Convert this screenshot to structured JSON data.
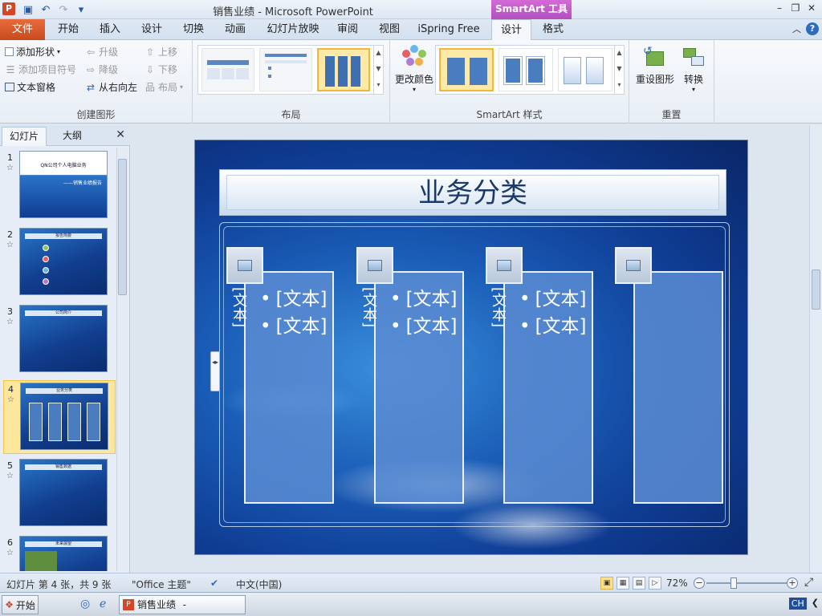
{
  "titlebar": {
    "window_title": "销售业绩 - Microsoft PowerPoint",
    "context_tools": "SmartArt 工具"
  },
  "tabs": {
    "file": "文件",
    "items": [
      "开始",
      "插入",
      "设计",
      "切换",
      "动画",
      "幻灯片放映",
      "审阅",
      "视图",
      "iSpring Free",
      "设计",
      "格式"
    ]
  },
  "ribbon": {
    "create_graphic": {
      "label": "创建图形",
      "add_shape": "添加形状",
      "add_bullet": "添加项目符号",
      "text_pane": "文本窗格",
      "promote": "升级",
      "demote": "降级",
      "right_to_left": "从右向左",
      "move_up": "上移",
      "move_down": "下移",
      "layout": "布局"
    },
    "layouts": {
      "label": "布局"
    },
    "styles": {
      "label": "SmartArt 样式",
      "change_colors": "更改颜色"
    },
    "reset": {
      "label": "重置",
      "reset_graphic": "重设图形",
      "convert": "转换"
    }
  },
  "leftpane": {
    "tab_slides": "幻灯片",
    "tab_outline": "大纲",
    "thumbnails": [
      {
        "num": "1",
        "title": "QN公司个人电脑业务",
        "subtitle": "——销售业绩报告"
      },
      {
        "num": "2",
        "title": "报告简要"
      },
      {
        "num": "3",
        "title": "公司简介"
      },
      {
        "num": "4",
        "title": "业务分类"
      },
      {
        "num": "5",
        "title": "销售数据"
      },
      {
        "num": "6",
        "title": "未来展望"
      }
    ]
  },
  "slide": {
    "title": "业务分类",
    "columns": [
      {
        "side_label": "[文本]",
        "bullets": [
          "[文本]",
          "[文本]"
        ]
      },
      {
        "side_label": "[文本]",
        "bullets": [
          "[文本]",
          "[文本]"
        ]
      },
      {
        "side_label": "[文本]",
        "bullets": [
          "[文本]",
          "[文本]"
        ]
      },
      {
        "side_label": "",
        "bullets": []
      }
    ]
  },
  "statusbar": {
    "slide_info": "幻灯片 第 4 张，共 9 张",
    "theme": "\"Office 主题\"",
    "language": "中文(中国)",
    "zoom": "72%"
  },
  "taskbar": {
    "start": "开始",
    "task_label": "销售业绩 - Microsof...",
    "ime": "CH"
  }
}
